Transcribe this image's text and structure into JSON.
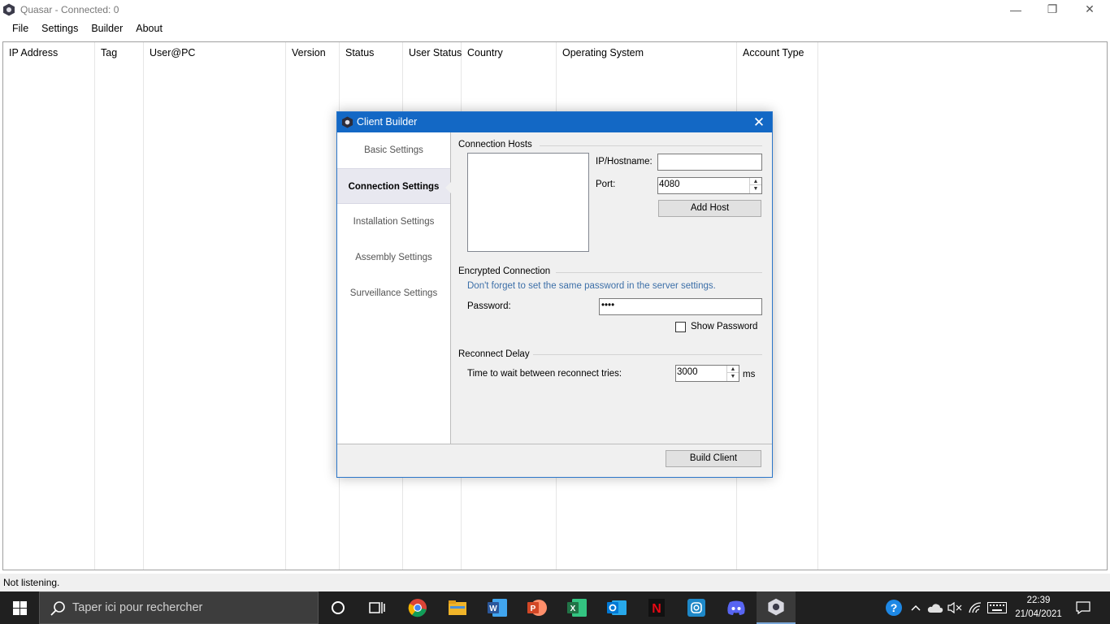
{
  "window": {
    "title": "Quasar - Connected: 0",
    "minimize": "—",
    "restore": "❐",
    "close": "✕"
  },
  "menu": [
    "File",
    "Settings",
    "Builder",
    "About"
  ],
  "columns": [
    "IP Address",
    "Tag",
    "User@PC",
    "Version",
    "Status",
    "User Status",
    "Country",
    "Operating System",
    "Account Type"
  ],
  "status_bar": "Not listening.",
  "dialog": {
    "title": "Client Builder",
    "close": "✕",
    "nav": [
      "Basic Settings",
      "Connection Settings",
      "Installation Settings",
      "Assembly Settings",
      "Surveillance Settings"
    ],
    "active_nav": "Connection Settings",
    "connection_hosts": {
      "group": "Connection Hosts",
      "ip_label": "IP/Hostname:",
      "ip_value": "",
      "port_label": "Port:",
      "port_value": "4080",
      "add_host": "Add Host"
    },
    "encryption": {
      "group": "Encrypted Connection",
      "hint": "Don't forget to set the same password in the server settings.",
      "password_label": "Password:",
      "password_value": "••••",
      "show_password": "Show Password",
      "show_password_checked": false
    },
    "reconnect": {
      "group": "Reconnect Delay",
      "label": "Time to wait between reconnect tries:",
      "value": "3000",
      "unit": "ms"
    },
    "build_button": "Build Client"
  },
  "taskbar": {
    "search_placeholder": "Taper ici pour rechercher",
    "apps": [
      "cortana",
      "task-view",
      "chrome",
      "file-explorer",
      "word",
      "powerpoint",
      "excel",
      "outlook",
      "netflix",
      "instagram",
      "discord",
      "quasar"
    ],
    "time": "22:39",
    "date": "21/04/2021",
    "colors": {
      "chrome": "#db4437",
      "explorer": "#f0b429",
      "word": "#2b579a",
      "powerpoint": "#d24726",
      "excel": "#217346",
      "outlook": "#0078d4",
      "netflix": "#e50914",
      "instagram": "#1e88c8",
      "discord": "#5865f2"
    }
  }
}
